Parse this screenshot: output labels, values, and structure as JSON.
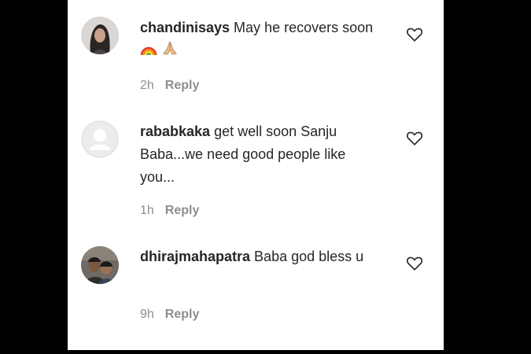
{
  "comments": [
    {
      "username": "chandinisays",
      "text": "May he recovers soon",
      "emojis": [
        "rainbow-emoji",
        "folded-hands-emoji"
      ],
      "time": "2h",
      "reply_label": "Reply",
      "avatar": "user-photo"
    },
    {
      "username": "rababkaka",
      "text": "get well soon Sanju Baba...we need good people like you...",
      "time": "1h",
      "reply_label": "Reply",
      "avatar": "default-avatar"
    },
    {
      "username": "dhirajmahapatra",
      "text": "Baba god bless u",
      "time": "9h",
      "reply_label": "Reply",
      "avatar": "user-photo"
    }
  ],
  "colors": {
    "text": "#262626",
    "secondary": "#8e8e8e",
    "background": "#ffffff",
    "frame": "#000000"
  }
}
